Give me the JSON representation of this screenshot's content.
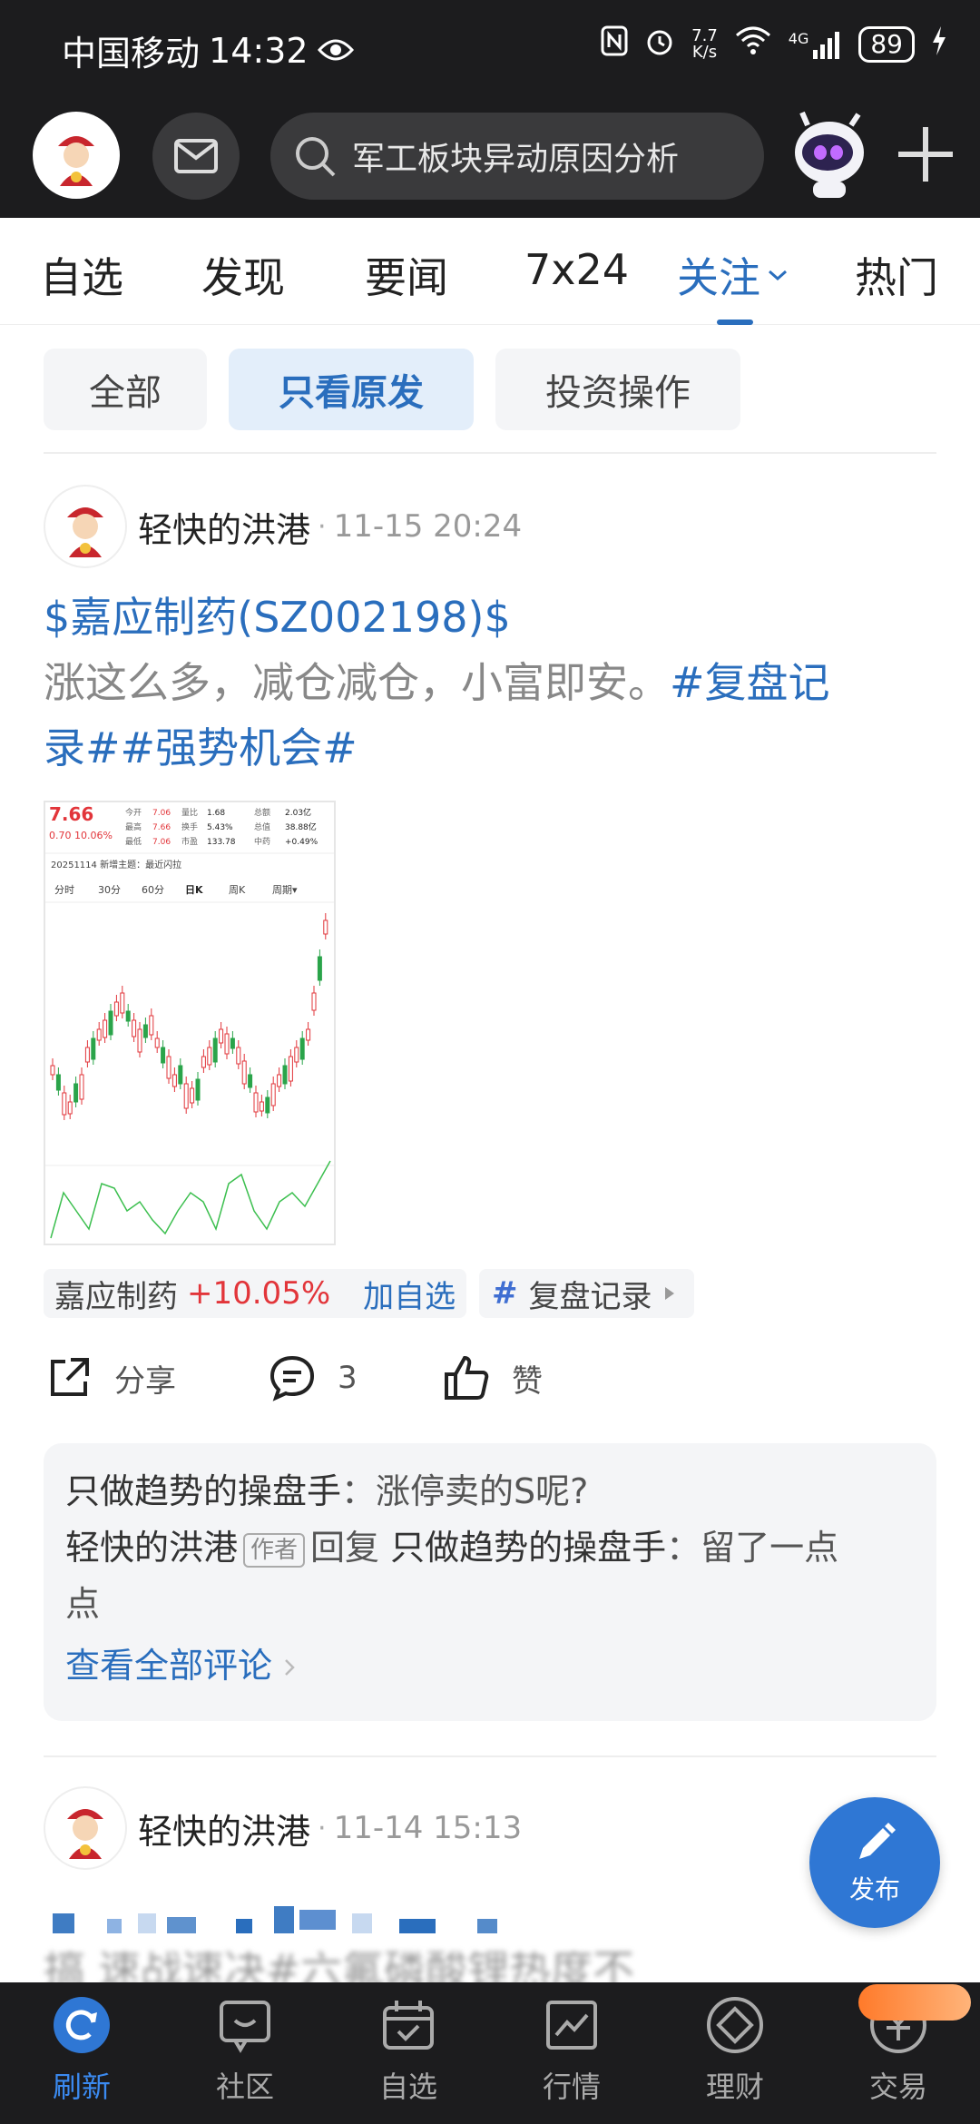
{
  "status_bar": {
    "carrier": "中国移动",
    "time": "14:32",
    "net_speed_value": "7.7",
    "net_speed_unit": "K/s",
    "network": "4G",
    "battery": "89"
  },
  "header": {
    "search_text": "军工板块异动原因分析"
  },
  "tabs": [
    {
      "label": "自选"
    },
    {
      "label": "发现"
    },
    {
      "label": "要闻"
    },
    {
      "label": "7x24"
    },
    {
      "label": "关注"
    },
    {
      "label": "热门"
    }
  ],
  "filters": [
    {
      "label": "全部"
    },
    {
      "label": "只看原发"
    },
    {
      "label": "投资操作"
    }
  ],
  "post1": {
    "author": "轻快的洪港",
    "time": "11-15 20:24",
    "stock_ref": "$嘉应制药(SZ002198)$",
    "text_plain": "涨这么多，减仓减仓，小富即安。",
    "tag1": "#复盘记",
    "tag1b": "录##强势机会#",
    "chart": {
      "price": "7.66",
      "change": "0.70 10.06%",
      "rows": [
        [
          "今开",
          "7.06",
          "量比",
          "1.68",
          "总额",
          "2.03亿"
        ],
        [
          "最高",
          "7.66",
          "换手",
          "5.43%",
          "总值",
          "38.88亿"
        ],
        [
          "最低",
          "7.06",
          "市盈",
          "133.78",
          "中药",
          "+0.49%"
        ]
      ],
      "banner": "20251114 新增主题：最近闪拉",
      "periods": [
        "分时",
        "30分",
        "60分",
        "日K",
        "周K",
        "周期▾"
      ]
    },
    "stock_chip": {
      "name": "嘉应制药",
      "change": "+10.05%",
      "add": "加自选"
    },
    "topic_chip": {
      "hash": "#",
      "label": "复盘记录"
    },
    "actions": {
      "share": "分享",
      "comments": "3",
      "like": "赞"
    },
    "comments": {
      "c1_user": "只做趋势的操盘手",
      "c1_text": "：涨停卖的S呢?",
      "c2_user": "轻快的洪港",
      "c2_badge": "作者",
      "c2_reply": "回复",
      "c2_target": "只做趋势的操盘手",
      "c2_text_a": "：留了一点",
      "c2_text_b": "点",
      "view_all": "查看全部评论"
    }
  },
  "post2": {
    "author": "轻快的洪港",
    "time": "11-14 15:13",
    "partial": "搞  速战速决#六氟磷酸锂热度不"
  },
  "fab": {
    "label": "发布"
  },
  "bottom_nav": [
    {
      "label": "刷新",
      "icon": "refresh-icon"
    },
    {
      "label": "社区",
      "icon": "community-icon"
    },
    {
      "label": "自选",
      "icon": "watchlist-icon"
    },
    {
      "label": "行情",
      "icon": "market-icon"
    },
    {
      "label": "理财",
      "icon": "finance-icon"
    },
    {
      "label": "交易",
      "icon": "trade-icon"
    }
  ],
  "colors": {
    "accent": "#2a6ebd",
    "up": "#e2353a",
    "dark": "#1c1c1e"
  }
}
